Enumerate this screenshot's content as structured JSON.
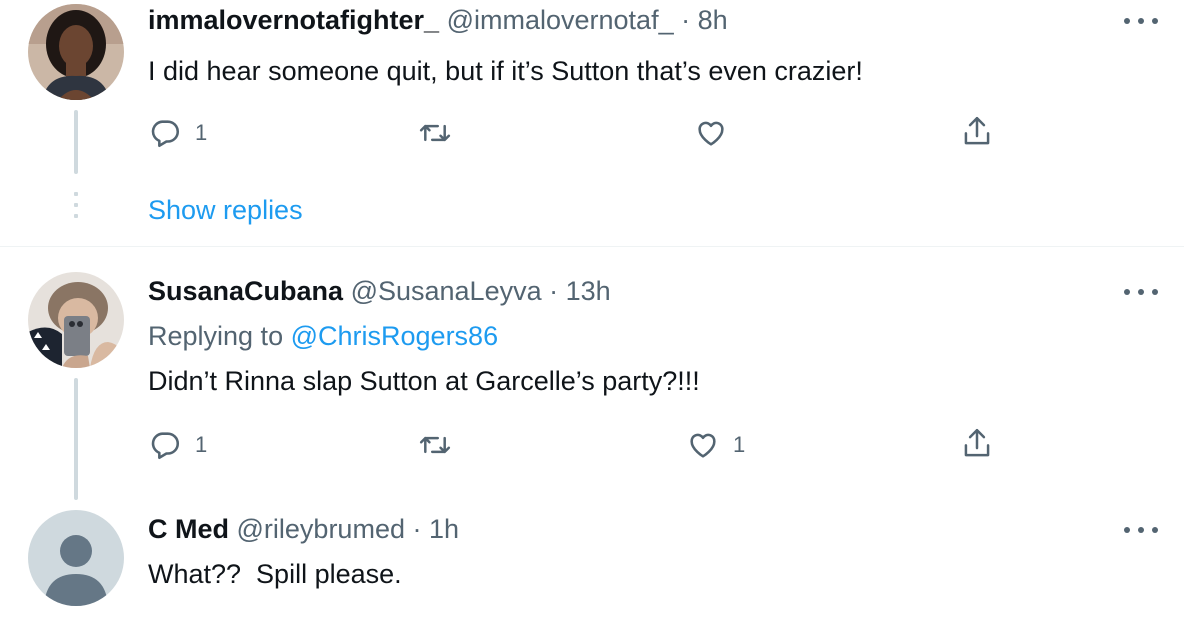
{
  "tweets": [
    {
      "display_name": "immalovernotafighter_",
      "handle": "@immalovernotaf_",
      "separator": "·",
      "time": "8h",
      "text": "I did hear someone quit, but if it’s Sutton that’s even crazier!",
      "reply_count": "1",
      "retweet_count": "",
      "like_count": ""
    },
    {
      "display_name": "SusanaCubana",
      "handle": "@SusanaLeyva",
      "separator": "·",
      "time": "13h",
      "replying_prefix": "Replying to",
      "replying_to": "@ChrisRogers86",
      "text": "Didn’t Rinna slap Sutton at Garcelle’s party?!!!",
      "reply_count": "1",
      "retweet_count": "",
      "like_count": "1"
    },
    {
      "display_name": "C Med",
      "handle": "@rileybrumed",
      "separator": "·",
      "time": "1h",
      "text": "What??  Spill please."
    }
  ],
  "show_replies_label": "Show replies",
  "colors": {
    "text": "#0f1419",
    "secondary": "#536471",
    "link": "#1d9bf0",
    "thread_line": "#cfd9de",
    "divider": "#eff3f4"
  },
  "icons": [
    "reply-icon",
    "retweet-icon",
    "like-icon",
    "share-icon",
    "more-icon",
    "default-avatar-icon"
  ]
}
